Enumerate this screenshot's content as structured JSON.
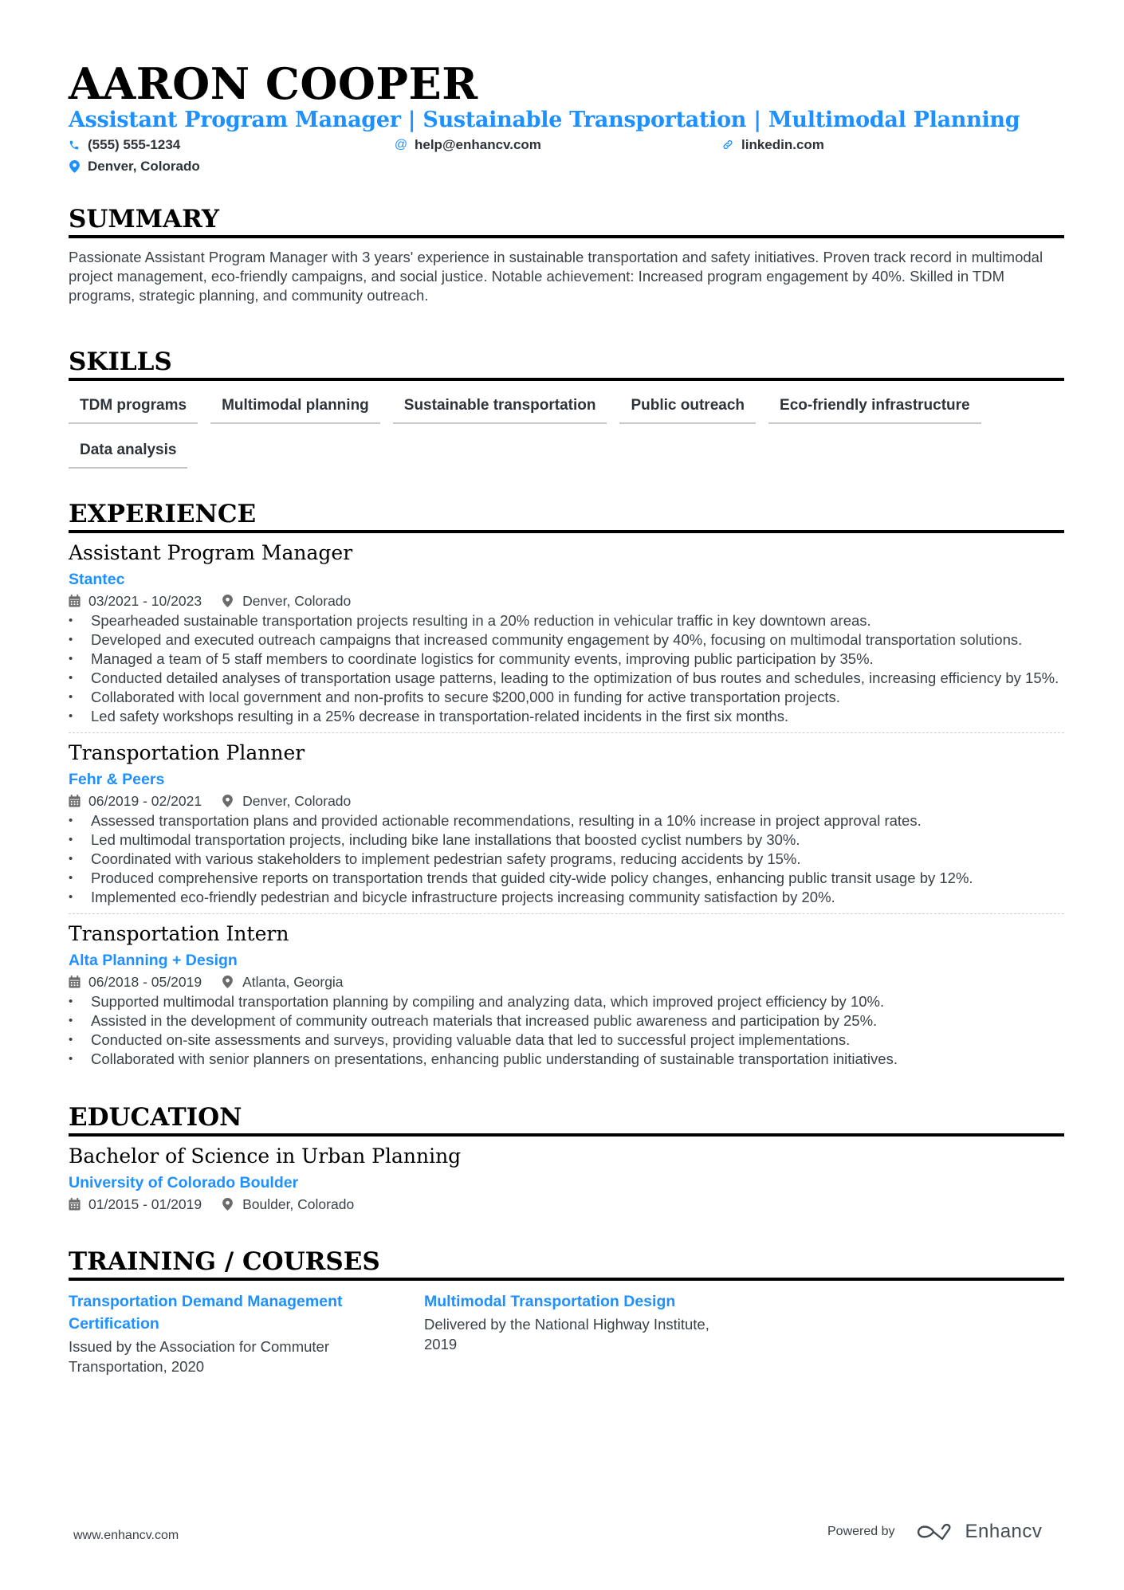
{
  "header": {
    "name": "AARON COOPER",
    "headline": "Assistant Program Manager | Sustainable Transportation | Multimodal Planning",
    "contacts": [
      {
        "icon": "phone-icon",
        "text": "(555) 555-1234"
      },
      {
        "icon": "at-icon",
        "text": "help@enhancv.com"
      },
      {
        "icon": "link-icon",
        "text": "linkedin.com"
      },
      {
        "icon": "location-icon",
        "text": "Denver, Colorado"
      }
    ]
  },
  "summary": {
    "title": "SUMMARY",
    "text": "Passionate Assistant Program Manager with 3 years' experience in sustainable transportation and safety initiatives. Proven track record in multimodal project management, eco-friendly campaigns, and social justice. Notable achievement: Increased program engagement by 40%. Skilled in TDM programs, strategic planning, and community outreach."
  },
  "skills": {
    "title": "SKILLS",
    "items": [
      "TDM programs",
      "Multimodal planning",
      "Sustainable transportation",
      "Public outreach",
      "Eco-friendly infrastructure",
      "Data analysis"
    ]
  },
  "experience": {
    "title": "EXPERIENCE",
    "jobs": [
      {
        "title": "Assistant Program Manager",
        "company": "Stantec",
        "dates": "03/2021 - 10/2023",
        "location": "Denver, Colorado",
        "bullets": [
          "Spearheaded sustainable transportation projects resulting in a 20% reduction in vehicular traffic in key downtown areas.",
          "Developed and executed outreach campaigns that increased community engagement by 40%, focusing on multimodal transportation solutions.",
          "Managed a team of 5 staff members to coordinate logistics for community events, improving public participation by 35%.",
          "Conducted detailed analyses of transportation usage patterns, leading to the optimization of bus routes and schedules, increasing efficiency by 15%.",
          "Collaborated with local government and non-profits to secure $200,000 in funding for active transportation projects.",
          "Led safety workshops resulting in a 25% decrease in transportation-related incidents in the first six months."
        ]
      },
      {
        "title": "Transportation Planner",
        "company": "Fehr & Peers",
        "dates": "06/2019 - 02/2021",
        "location": "Denver, Colorado",
        "bullets": [
          "Assessed transportation plans and provided actionable recommendations, resulting in a 10% increase in project approval rates.",
          "Led multimodal transportation projects, including bike lane installations that boosted cyclist numbers by 30%.",
          "Coordinated with various stakeholders to implement pedestrian safety programs, reducing accidents by 15%.",
          "Produced comprehensive reports on transportation trends that guided city-wide policy changes, enhancing public transit usage by 12%.",
          "Implemented eco-friendly pedestrian and bicycle infrastructure projects increasing community satisfaction by 20%."
        ]
      },
      {
        "title": "Transportation Intern",
        "company": "Alta Planning + Design",
        "dates": "06/2018 - 05/2019",
        "location": "Atlanta, Georgia",
        "bullets": [
          "Supported multimodal transportation planning by compiling and analyzing data, which improved project efficiency by 10%.",
          "Assisted in the development of community outreach materials that increased public awareness and participation by 25%.",
          "Conducted on-site assessments and surveys, providing valuable data that led to successful project implementations.",
          "Collaborated with senior planners on presentations, enhancing public understanding of sustainable transportation initiatives."
        ]
      }
    ]
  },
  "education": {
    "title": "EDUCATION",
    "degree": "Bachelor of Science in Urban Planning",
    "school": "University of Colorado Boulder",
    "dates": "01/2015 - 01/2019",
    "location": "Boulder, Colorado"
  },
  "training": {
    "title": "TRAINING / COURSES",
    "courses": [
      {
        "title": "Transportation Demand Management Certification",
        "description": "Issued by the Association for Commuter Transportation, 2020"
      },
      {
        "title": "Multimodal Transportation Design",
        "description": "Delivered by the National Highway Institute, 2019"
      }
    ]
  },
  "footer": {
    "website": "www.enhancv.com",
    "powered_by": "Powered by",
    "brand": "Enhancv"
  },
  "colors": {
    "accent": "#1e90ff",
    "text": "#2d3339",
    "heading": "#000000"
  }
}
